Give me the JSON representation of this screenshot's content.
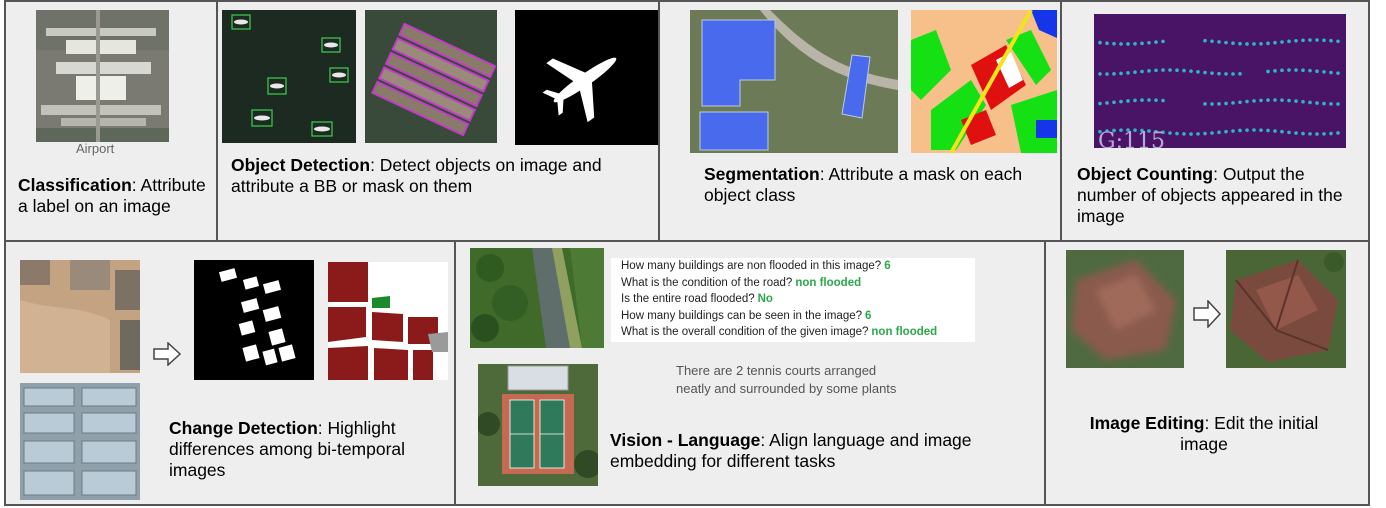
{
  "classification": {
    "image_label": "Airport",
    "title": "Classification",
    "desc": ": Attribute a label on an image"
  },
  "detection": {
    "title": "Object Detection",
    "desc": ": Detect objects on image and attribute a BB or mask on them"
  },
  "segmentation": {
    "title": "Segmentation",
    "desc": ": Attribute a mask on each object class"
  },
  "counting": {
    "overlay": "G:115",
    "title": "Object Counting",
    "desc": ": Output the number of objects appeared in the image"
  },
  "change": {
    "title": "Change Detection",
    "desc": ": Highlight differences among bi-temporal images"
  },
  "vision_language": {
    "qa": [
      {
        "q": "How many buildings are non flooded in this image?",
        "a": "6"
      },
      {
        "q": "What is the condition of the road?",
        "a": "non flooded"
      },
      {
        "q": "Is the entire road flooded?",
        "a": "No"
      },
      {
        "q": "How many buildings can be seen in the image?",
        "a": "6"
      },
      {
        "q": "What is the overall condition of the given image?",
        "a": "non flooded"
      }
    ],
    "caption_text": "There are 2 tennis courts arranged neatly and surrounded by some plants",
    "title": "Vision - Language",
    "desc": ": Align language and image embedding for different tasks"
  },
  "editing": {
    "title": "Image Editing",
    "desc": ": Edit the initial image"
  },
  "colors": {
    "panel_bg": "#eeeeee",
    "border": "#555555",
    "answer_green": "#2aa84a",
    "mask_red": "#8b1a1a",
    "seg_orange": "#f7c08a",
    "count_purple": "#4a1466",
    "count_dot": "#2fb5c8"
  }
}
